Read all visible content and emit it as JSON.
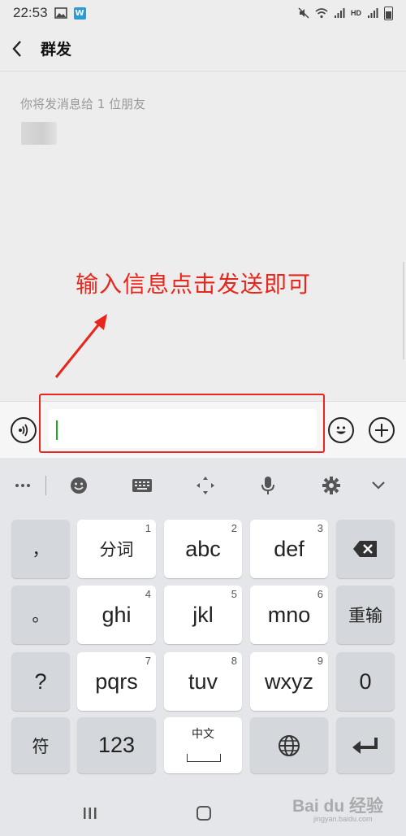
{
  "status_bar": {
    "time": "22:53",
    "app_badge": "W",
    "network_label": "HD"
  },
  "header": {
    "title": "群发"
  },
  "content": {
    "recipient_note": "你将发消息给 1 位朋友",
    "annotation": "输入信息点击发送即可"
  },
  "input": {
    "value": "",
    "placeholder": ""
  },
  "keyboard": {
    "rows": [
      [
        {
          "label": "，",
          "num": ""
        },
        {
          "label": "分词",
          "num": "1"
        },
        {
          "label": "abc",
          "num": "2"
        },
        {
          "label": "def",
          "num": "3"
        },
        {
          "label": "⌫",
          "num": ""
        }
      ],
      [
        {
          "label": "。",
          "num": ""
        },
        {
          "label": "ghi",
          "num": "4"
        },
        {
          "label": "jkl",
          "num": "5"
        },
        {
          "label": "mno",
          "num": "6"
        },
        {
          "label": "重输",
          "num": ""
        }
      ],
      [
        {
          "label": "?",
          "num": ""
        },
        {
          "label": "pqrs",
          "num": "7"
        },
        {
          "label": "tuv",
          "num": "8"
        },
        {
          "label": "wxyz",
          "num": "9"
        },
        {
          "label": "0",
          "num": ""
        }
      ],
      [
        {
          "label": "符",
          "num": ""
        },
        {
          "label": "123",
          "num": ""
        },
        {
          "label": "中文",
          "num": ""
        },
        {
          "label": "globe",
          "num": ""
        },
        {
          "label": "enter",
          "num": ""
        }
      ]
    ]
  },
  "watermark": {
    "brand": "Bai du 经验",
    "url": "jingyan.baidu.com"
  },
  "colors": {
    "annotation": "#e8261b",
    "cursor": "#1aad19",
    "keyboard_bg": "#e4e6e9"
  },
  "icons": {
    "header": "back-chevron-icon",
    "input_bar": [
      "voice-icon",
      "emoji-icon",
      "plus-icon"
    ],
    "keyboard_toolbar": [
      "more-dots-icon",
      "emoji-face-icon",
      "keyboard-icon",
      "cursor-move-icon",
      "microphone-icon",
      "settings-gear-icon",
      "collapse-chevron-icon"
    ]
  }
}
